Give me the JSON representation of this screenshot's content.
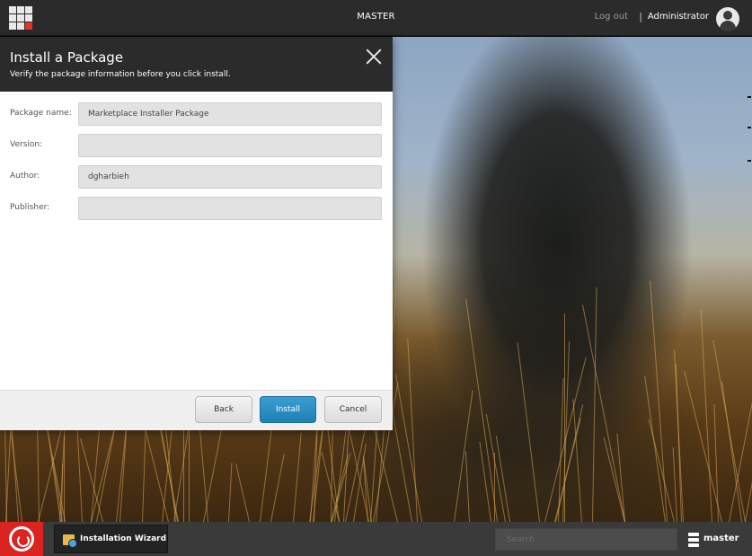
{
  "topbar": {
    "database_label": "MASTER",
    "logout_label": "Log out",
    "separator": "|",
    "username": "Administrator",
    "avatar_icon": "user-avatar-icon"
  },
  "dialog": {
    "title": "Install a Package",
    "subtitle": "Verify the package information before you click install.",
    "close_icon": "close-icon",
    "fields": [
      {
        "label": "Package name:",
        "value": "Marketplace Installer Package"
      },
      {
        "label": "Version:",
        "value": ""
      },
      {
        "label": "Author:",
        "value": "dgharbieh"
      },
      {
        "label": "Publisher:",
        "value": ""
      }
    ],
    "buttons": {
      "back": "Back",
      "install": "Install",
      "cancel": "Cancel"
    }
  },
  "taskbar": {
    "start_icon": "sitecore-start-icon",
    "task_label": "Installation Wizard",
    "task_icon": "installation-wizard-icon",
    "search_placeholder": "Search",
    "database_icon": "database-icon",
    "database_name": "master"
  },
  "colors": {
    "topbar": "#2b2b2b",
    "accent_red": "#d9241f",
    "install_button": "#2a8fc4",
    "field_bg": "#e2e2e2"
  }
}
